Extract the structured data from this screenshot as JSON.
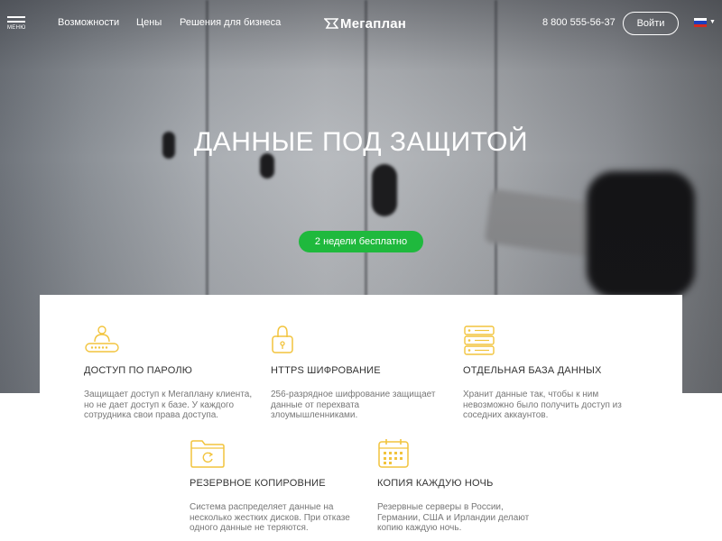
{
  "header": {
    "menu_label": "МЕНЮ",
    "nav": [
      "Возможности",
      "Цены",
      "Решения для бизнеса"
    ],
    "logo_text": "Мегаплан",
    "phone": "8 800 555-56-37",
    "login_label": "Войти",
    "language_flag": "russia-flag-icon"
  },
  "hero": {
    "title": "ДАННЫЕ ПОД ЗАЩИТОЙ",
    "cta_label": "2 недели бесплатно"
  },
  "colors": {
    "accent_green": "#1fb93d",
    "icon_yellow": "#f2c43d"
  },
  "features": [
    {
      "icon": "user-password-icon",
      "title": "ДОСТУП ПО ПАРОЛЮ",
      "description": "Защищает доступ к Мегаплану клиента, но не дает доступ к базе. У каждого сотрудника свои права доступа."
    },
    {
      "icon": "padlock-icon",
      "title": "HTTPS ШИФРОВАНИЕ",
      "description": "256-разрядное шифрование защищает данные от перехвата злоумышленниками."
    },
    {
      "icon": "server-icon",
      "title": "ОТДЕЛЬНАЯ БАЗА ДАННЫХ",
      "description": "Хранит данные так, чтобы к ним невозможно было получить доступ из соседних аккаунтов."
    },
    {
      "icon": "folder-backup-icon",
      "title": "РЕЗЕРВНОЕ КОПИРОВНИЕ",
      "description": "Система распределяет данные на несколько жестких дисков. При отказе одного данные не теряются."
    },
    {
      "icon": "calendar-icon",
      "title": "КОПИЯ КАЖДУЮ НОЧЬ",
      "description": "Резервные серверы в России, Германии, США и Ирландии делают копию каждую ночь."
    }
  ]
}
